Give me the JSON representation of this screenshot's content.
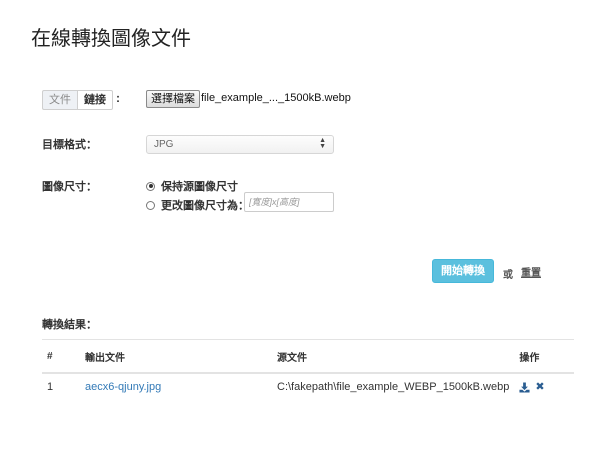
{
  "page": {
    "title": "在線轉換圖像文件"
  },
  "source": {
    "tabs": [
      {
        "label": "文件",
        "active": true
      },
      {
        "label": "鏈接",
        "active": false
      }
    ],
    "colon": ":",
    "file_button_label": "選擇檔案",
    "file_name": "file_example_..._1500kB.webp"
  },
  "format": {
    "label": "目標格式：",
    "selected": "JPG"
  },
  "size": {
    "label": "圖像尺寸：",
    "options": [
      {
        "label": "保持源圖像尺寸",
        "checked": true
      },
      {
        "label": "更改圖像尺寸為：",
        "checked": false
      }
    ],
    "input_placeholder": "[寬度]x[高度]"
  },
  "actions": {
    "convert_label": "開始轉換",
    "or_text": "或",
    "reset_label": "重置"
  },
  "results": {
    "label": "轉換結果：",
    "columns": [
      "#",
      "輸出文件",
      "源文件",
      "操作"
    ],
    "rows": [
      {
        "index": "1",
        "output": "aecx6-qjuny.jpg",
        "source": "C:\\fakepath\\file_example_WEBP_1500kB.webp"
      }
    ]
  },
  "colors": {
    "accent": "#5bc0de",
    "link": "#337ab7",
    "icon": "#2a5d91"
  },
  "icons": {
    "download": "download-icon",
    "delete": "close-icon"
  }
}
